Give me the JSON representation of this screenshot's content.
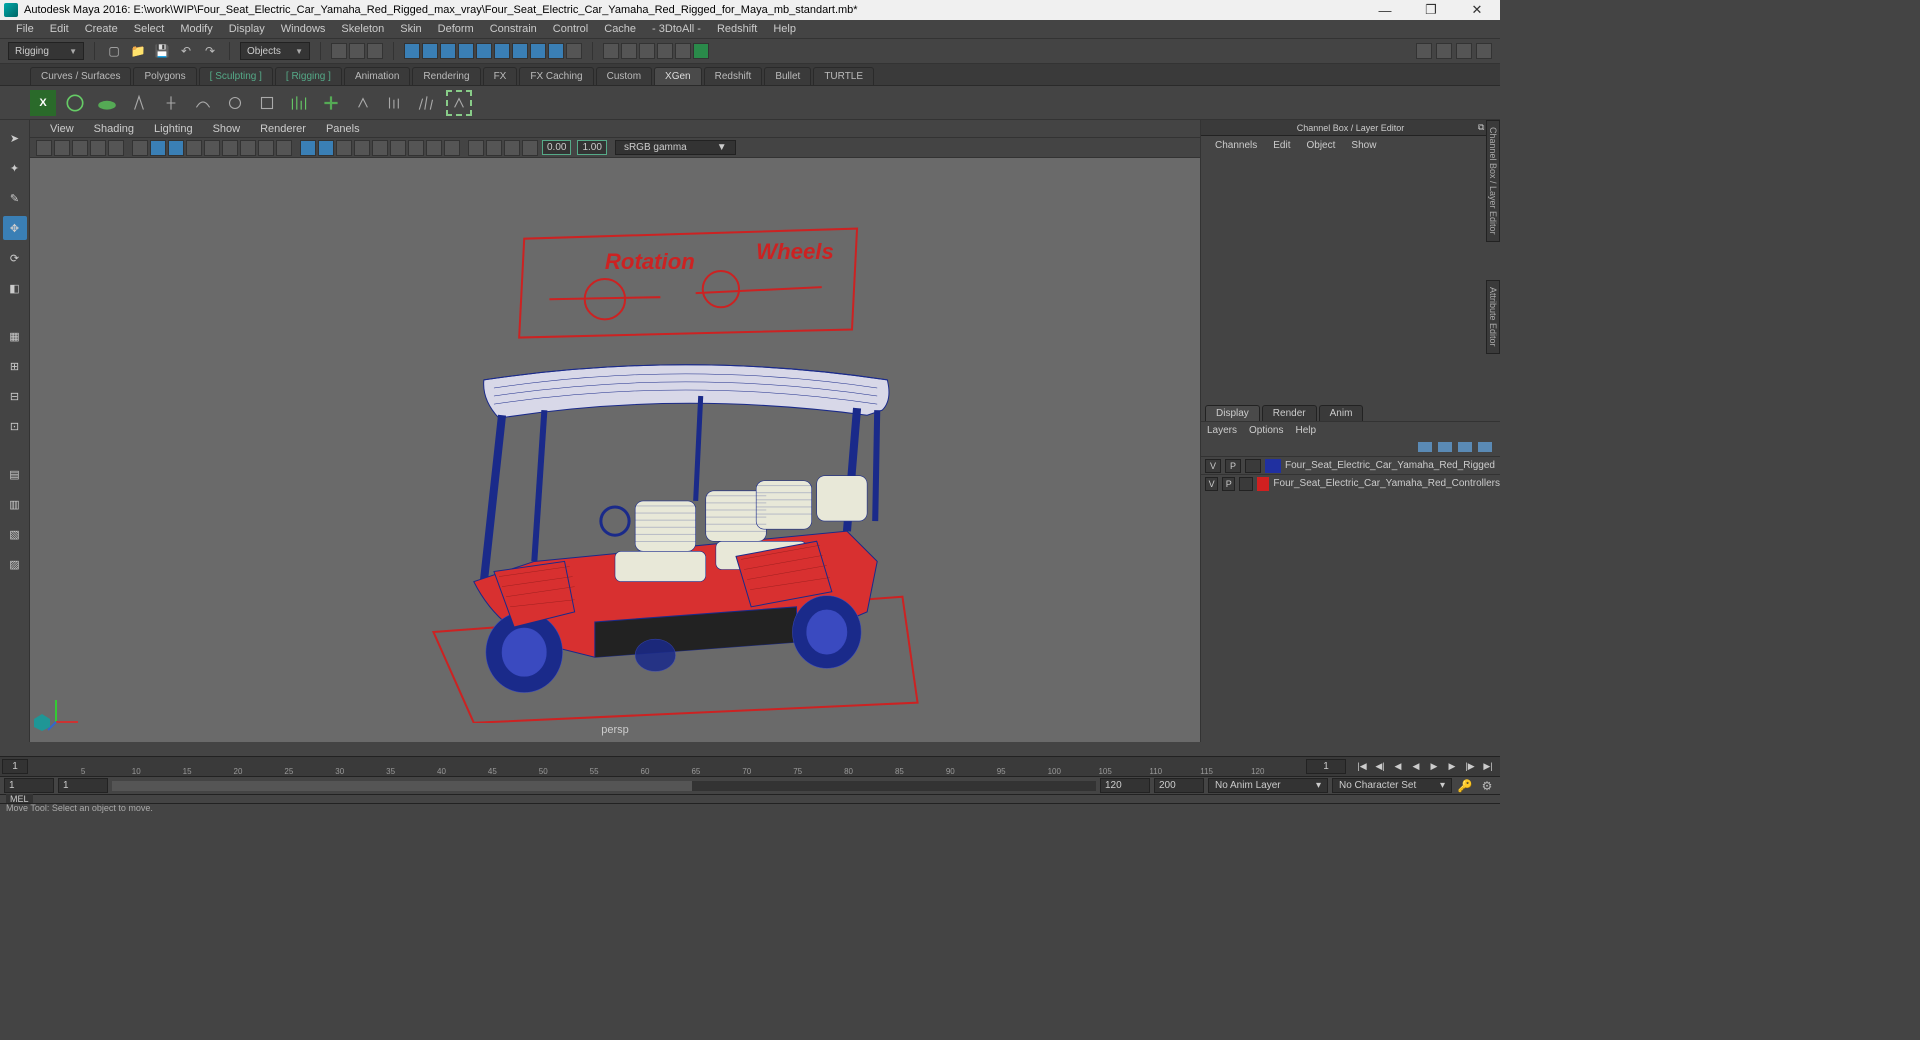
{
  "title": "Autodesk Maya 2016: E:\\work\\WIP\\Four_Seat_Electric_Car_Yamaha_Red_Rigged_max_vray\\Four_Seat_Electric_Car_Yamaha_Red_Rigged_for_Maya_mb_standart.mb*",
  "mainmenu": [
    "File",
    "Edit",
    "Create",
    "Select",
    "Modify",
    "Display",
    "Windows",
    "Skeleton",
    "Skin",
    "Deform",
    "Constrain",
    "Control",
    "Cache",
    "- 3DtoAll -",
    "Redshift",
    "Help"
  ],
  "module": "Rigging",
  "objects_label": "Objects",
  "shelftabs": [
    {
      "label": "Curves / Surfaces"
    },
    {
      "label": "Polygons"
    },
    {
      "label": "Sculpting",
      "bracket": true
    },
    {
      "label": "Rigging",
      "bracket": true
    },
    {
      "label": "Animation"
    },
    {
      "label": "Rendering"
    },
    {
      "label": "FX"
    },
    {
      "label": "FX Caching"
    },
    {
      "label": "Custom"
    },
    {
      "label": "XGen",
      "active": true
    },
    {
      "label": "Redshift"
    },
    {
      "label": "Bullet"
    },
    {
      "label": "TURTLE"
    }
  ],
  "vpmenu": [
    "View",
    "Shading",
    "Lighting",
    "Show",
    "Renderer",
    "Panels"
  ],
  "vp_num1": "0.00",
  "vp_num2": "1.00",
  "gamma": "sRGB gamma",
  "persp": "persp",
  "control_labels": {
    "rotation": "Rotation",
    "wheels": "Wheels"
  },
  "channelbox": {
    "title": "Channel Box / Layer Editor",
    "menu": [
      "Channels",
      "Edit",
      "Object",
      "Show"
    ]
  },
  "layertabs": [
    "Display",
    "Render",
    "Anim"
  ],
  "layermenu": [
    "Layers",
    "Options",
    "Help"
  ],
  "layers": [
    {
      "v": "V",
      "p": "P",
      "color": "#2030a0",
      "name": "Four_Seat_Electric_Car_Yamaha_Red_Rigged"
    },
    {
      "v": "V",
      "p": "P",
      "color": "#d02020",
      "name": "Four_Seat_Electric_Car_Yamaha_Red_Controllers"
    }
  ],
  "timeline": {
    "cur": "1",
    "end": "1",
    "ticks": [
      5,
      10,
      15,
      20,
      25,
      30,
      35,
      40,
      45,
      50,
      55,
      60,
      65,
      70,
      75,
      80,
      85,
      90,
      95,
      100,
      105,
      110,
      115,
      120
    ]
  },
  "range": {
    "start": "1",
    "innerstart": "1",
    "innerend": "120",
    "end": "120",
    "endouter": "200"
  },
  "animlayer": "No Anim Layer",
  "charset": "No Character Set",
  "cmd": "MEL",
  "status": "Move Tool: Select an object to move."
}
